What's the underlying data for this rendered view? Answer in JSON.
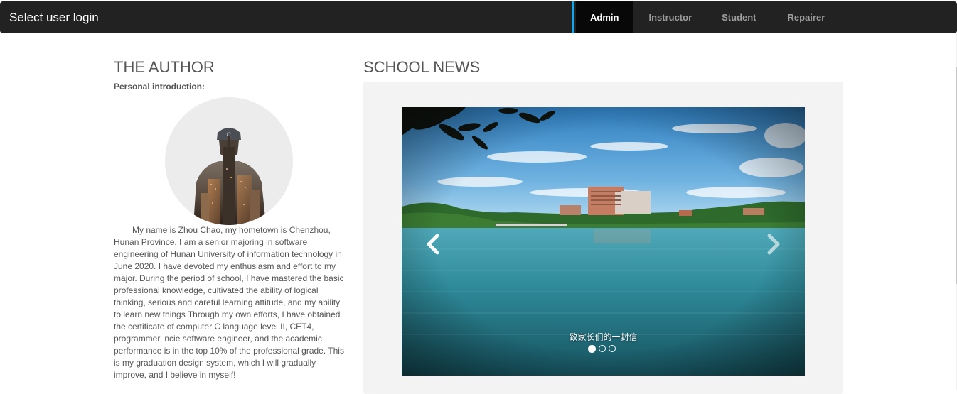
{
  "navbar": {
    "brand": "Select user login",
    "tabs": [
      {
        "label": "Admin",
        "active": true
      },
      {
        "label": "Instructor",
        "active": false
      },
      {
        "label": "Student",
        "active": false
      },
      {
        "label": "Repairer",
        "active": false
      }
    ],
    "accent_color": "#2a9fd6"
  },
  "author": {
    "heading": "THE AUTHOR",
    "intro_label": "Personal introduction:",
    "bio": "My name is Zhou Chao, my hometown is Chenzhou, Hunan Province, I am a senior majoring in software engineering of Hunan University of information technology in June 2020. I have devoted my enthusiasm and effort to my major. During the period of school, I have mastered the basic professional knowledge, cultivated the ability of logical thinking, serious and careful learning attitude, and my ability to learn new things Through my own efforts, I have obtained the certificate of computer C language level II, CET4, programmer, ncie software engineer, and the academic performance is in the top 10% of the professional grade. This is my graduation design system, which I will gradually improve, and I believe in myself!"
  },
  "news": {
    "heading": "SCHOOL NEWS",
    "carousel": {
      "caption": "致家长们的一封信",
      "slide_count": 3,
      "active_index": 0,
      "prev_icon": "chevron-left-icon",
      "next_icon": "chevron-right-icon"
    }
  }
}
